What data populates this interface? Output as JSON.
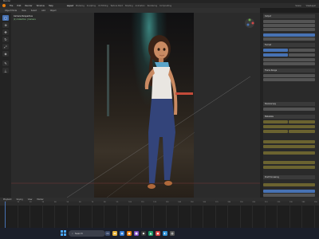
{
  "app": {
    "title": "Blender",
    "menu": [
      "File",
      "Edit",
      "Render",
      "Window",
      "Help"
    ],
    "workspace_tabs": [
      "Layout",
      "Modeling",
      "Sculpting",
      "UV Editing",
      "Texture Paint",
      "Shading",
      "Animation",
      "Rendering",
      "Compositing"
    ],
    "scene_label": "Scene",
    "view_layer_label": "ViewLayer"
  },
  "viewport_header": {
    "items": [
      "Object Mode",
      "View",
      "Select",
      "Add",
      "Object"
    ]
  },
  "viewport": {
    "overlay_line1": "Camera Perspective",
    "overlay_line2": "(1) Collection | Camera",
    "colors": {
      "glow": "#5adcd2",
      "floor": "#3a3228"
    }
  },
  "toolbar": {
    "tools": [
      "cursor",
      "move",
      "rotate",
      "scale",
      "transform",
      "annotate",
      "measure",
      "add"
    ]
  },
  "properties": {
    "sections": [
      "Output",
      "Format",
      "Frame Range",
      "Stereoscopy",
      "Metadata",
      "Post Processing"
    ]
  },
  "timeline": {
    "header_items": [
      "Playback",
      "Keying",
      "View",
      "Marker"
    ],
    "ticks": [
      "0",
      "10",
      "20",
      "30",
      "40",
      "50",
      "60",
      "70",
      "80",
      "90",
      "100",
      "110",
      "120",
      "130",
      "140",
      "150",
      "160",
      "170",
      "180",
      "190",
      "200",
      "210",
      "220",
      "230",
      "240",
      "250"
    ]
  },
  "taskbar": {
    "search_placeholder": "Search",
    "time": "",
    "accent": "#4aa8ff"
  }
}
